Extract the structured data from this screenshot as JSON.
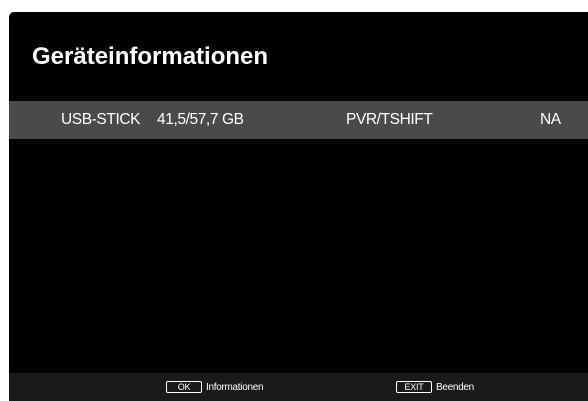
{
  "screen": {
    "title": "Geräteinformationen"
  },
  "device": {
    "name": "USB-STICK",
    "capacity": "41,5/57,7 GB",
    "function": "PVR/TSHIFT",
    "status": "NA"
  },
  "footer": {
    "ok_key": "OK",
    "ok_label": "Informationen",
    "exit_key": "EXIT",
    "exit_label": "Beenden"
  },
  "colors": {
    "background": "#010101",
    "row_highlight": "#4a4a4a",
    "footer_bar": "#1a1a1a",
    "text": "#ffffff"
  }
}
